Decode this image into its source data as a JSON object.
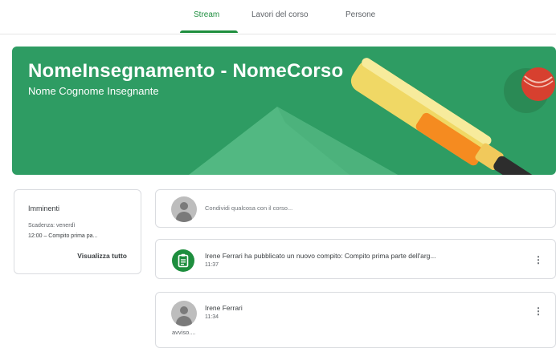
{
  "nav": {
    "tabs": [
      {
        "label": "Stream"
      },
      {
        "label": "Lavori del corso"
      },
      {
        "label": "Persone"
      }
    ]
  },
  "banner": {
    "title": "NomeInsegnamento - NomeCorso",
    "teacher": "Nome Cognome Insegnante",
    "theme_color": "#2e9c63",
    "illustration": "cricket-bat-ball"
  },
  "upcoming": {
    "title": "Imminenti",
    "due": "Scadenza: venerdì",
    "item": "12:00 – Compito prima pa...",
    "view_all": "Visualizza tutto"
  },
  "share": {
    "placeholder": "Condividi qualcosa con il corso..."
  },
  "posts": [
    {
      "icon": "assignment-icon",
      "text": "Irene Ferrari ha pubblicato un nuovo compito: Compito prima parte dell'arg...",
      "time": "11:37"
    },
    {
      "author": "Irene Ferrari",
      "time": "11:34",
      "body": "avviso...."
    }
  ],
  "colors": {
    "accent": "#1e8e3e"
  }
}
